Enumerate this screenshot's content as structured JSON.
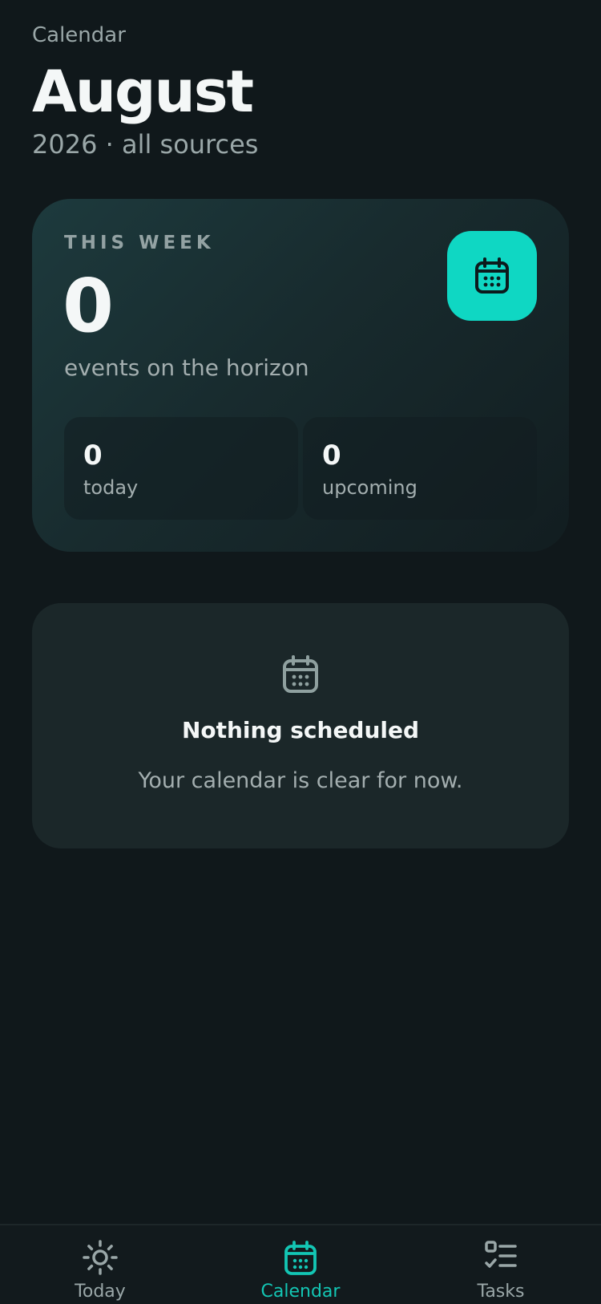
{
  "header": {
    "eyebrow": "Calendar",
    "title": "August",
    "subtitle": "2026 · all sources"
  },
  "week_card": {
    "label": "THIS WEEK",
    "count": "0",
    "caption": "events on the horizon",
    "icon": "calendar-icon",
    "stats": [
      {
        "value": "0",
        "label": "today"
      },
      {
        "value": "0",
        "label": "upcoming"
      }
    ]
  },
  "empty_state": {
    "icon": "calendar-icon",
    "title": "Nothing scheduled",
    "text": "Your calendar is clear for now."
  },
  "tabbar": {
    "tabs": [
      {
        "label": "Today",
        "icon": "sun-icon",
        "active": false
      },
      {
        "label": "Calendar",
        "icon": "calendar-icon",
        "active": true
      },
      {
        "label": "Tasks",
        "icon": "checklist-icon",
        "active": false
      }
    ]
  },
  "colors": {
    "background": "#10181b",
    "accent": "#0fd7c3",
    "card": "#1b2729",
    "muted_text": "#9aa7a8"
  }
}
